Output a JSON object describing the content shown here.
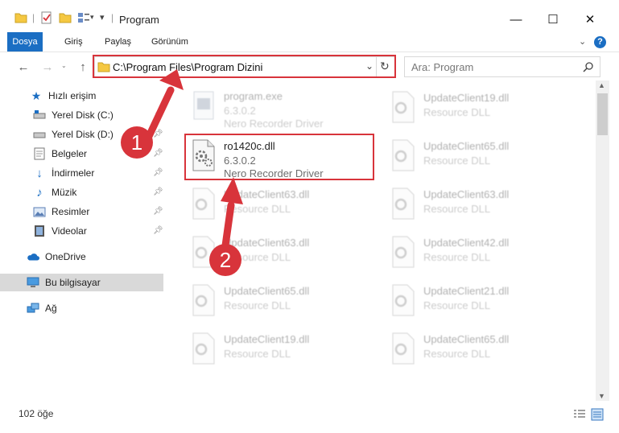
{
  "window": {
    "title": "Program",
    "minimize": "—",
    "maximize": "☐",
    "close": "✕"
  },
  "ribbon": {
    "tabs": [
      "Dosya",
      "Giriş",
      "Paylaş",
      "Görünüm"
    ],
    "help": "?"
  },
  "nav": {
    "back": "←",
    "forward": "→",
    "up": "↑",
    "address": "C:\\Program Files\\Program Dizini",
    "search_placeholder": "Ara: Program"
  },
  "sidebar": {
    "items": [
      {
        "label": "Hızlı erişim",
        "icon": "star-icon"
      },
      {
        "label": "Yerel Disk (C:)",
        "icon": "drive-icon",
        "pinned": true
      },
      {
        "label": "Yerel Disk (D:)",
        "icon": "drive-icon",
        "pinned": true
      },
      {
        "label": "Belgeler",
        "icon": "documents-icon",
        "pinned": true
      },
      {
        "label": "İndirmeler",
        "icon": "download-icon",
        "pinned": true
      },
      {
        "label": "Müzik",
        "icon": "music-icon",
        "pinned": true
      },
      {
        "label": "Resimler",
        "icon": "pictures-icon",
        "pinned": true
      },
      {
        "label": "Videolar",
        "icon": "video-icon",
        "pinned": true
      },
      {
        "label": "OneDrive",
        "icon": "cloud-icon"
      },
      {
        "label": "Bu bilgisayar",
        "icon": "computer-icon",
        "selected": true
      },
      {
        "label": "Ağ",
        "icon": "network-icon"
      }
    ]
  },
  "files": {
    "highlighted": {
      "name": "ro1420c.dll",
      "version": "6.3.0.2",
      "description": "Nero Recorder Driver"
    },
    "program": {
      "name": "program.exe",
      "version": "6.3.0.2",
      "description": "Nero Recorder Driver"
    },
    "left_column": [
      {
        "name": "UpdateClient63.dll",
        "type": "Resource DLL"
      },
      {
        "name": "UpdateClient63.dll",
        "type": "Resource DLL"
      },
      {
        "name": "UpdateClient65.dll",
        "type": "Resource DLL"
      },
      {
        "name": "UpdateClient19.dll",
        "type": "Resource DLL"
      }
    ],
    "right_column": [
      {
        "name": "UpdateClient19.dll",
        "type": "Resource DLL"
      },
      {
        "name": "UpdateClient65.dll",
        "type": "Resource DLL"
      },
      {
        "name": "UpdateClient63.dll",
        "type": "Resource DLL"
      },
      {
        "name": "UpdateClient42.dll",
        "type": "Resource DLL"
      },
      {
        "name": "UpdateClient21.dll",
        "type": "Resource DLL"
      },
      {
        "name": "UpdateClient65.dll",
        "type": "Resource DLL"
      }
    ]
  },
  "status": {
    "count": "102 öğe"
  },
  "annotations": {
    "step1": "1",
    "step2": "2",
    "color": "#d8343b"
  }
}
